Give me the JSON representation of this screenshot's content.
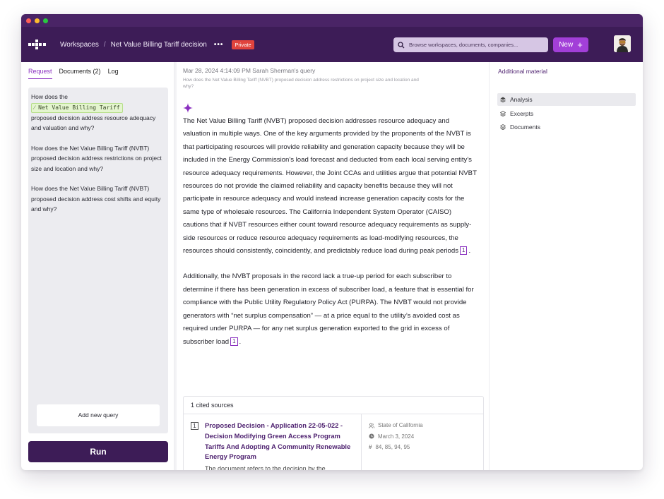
{
  "header": {
    "crumb_workspaces": "Workspaces",
    "crumb_sep": "/",
    "crumb_current": "Net Value Billing Tariff decision",
    "more": "•••",
    "badge": "Private",
    "search_placeholder": "Browse workspaces, documents, companies...",
    "new_label": "New",
    "new_icon": "+"
  },
  "window_dots": [
    "#ff5f57",
    "#febc2e",
    "#28c840"
  ],
  "left": {
    "tabs": {
      "request": "Request",
      "documents": "Documents (2)",
      "log": "Log"
    },
    "queries": {
      "q1_pre": "How does the",
      "q1_tag": "⁄ Net Value Billing Tariff",
      "q1_post": "proposed decision address resource adequacy and valuation and why?",
      "q2": "How does the Net Value Billing Tariff (NVBT) proposed decision address restrictions on project size and location and why?",
      "q3": "How does the Net Value Billing Tariff (NVBT) proposed decision address cost shifts and equity and why?"
    },
    "add_query": "Add new query",
    "run": "Run"
  },
  "main": {
    "meta": "Mar 28, 2024 4:14:09 PM  Sarah Sherman's query",
    "meta_sub": "How does the Net Value Billing Tariff (NVBT) proposed decision address restrictions on project size and location and why?",
    "para1": "The Net Value Billing Tariff (NVBT) proposed decision addresses resource adequacy and valuation in multiple ways. One of the key arguments provided by the proponents of the NVBT is that participating resources will provide reliability and generation capacity because they will be included in the Energy Commission's load forecast and deducted from each local serving entity's resource adequacy requirements. However, the Joint CCAs and utilities argue that potential NVBT resources do not provide the claimed reliability and capacity benefits because they will not participate in resource adequacy and would instead increase generation capacity costs for the same type of wholesale resources. The California Independent System Operator (CAISO) cautions that if NVBT resources either count toward resource adequacy requirements as supply-side resources or reduce resource adequacy requirements as load-modifying resources, the resources should consistently, coincidently, and predictably reduce load during peak periods",
    "para2": "Additionally, the NVBT proposals in the record lack a true-up period for each subscriber to determine if there has been generation in excess of subscriber load, a feature that is essential for compliance with the Public Utility Regulatory Policy Act (PURPA). The NVBT would not provide generators with “net surplus compensation” — at a price equal to the utility’s avoided cost as required under PURPA — for any net surplus generation exported to the grid in excess of subscriber load",
    "cite": "1",
    "end": "."
  },
  "sources": {
    "header": "1 cited sources",
    "num": "1",
    "title": "Proposed Decision - Application 22-05-022 - Decision Modifying Green Access Program Tariffs And Adopting A Community Renewable Energy Program",
    "snippet": "The document refers to the decision by the",
    "jurisdiction": "State of California",
    "date": "March 3, 2024",
    "pages": "84, 85, 94, 95"
  },
  "right": {
    "title": "Additional material",
    "items": [
      "Analysis",
      "Excerpts",
      "Documents"
    ]
  }
}
